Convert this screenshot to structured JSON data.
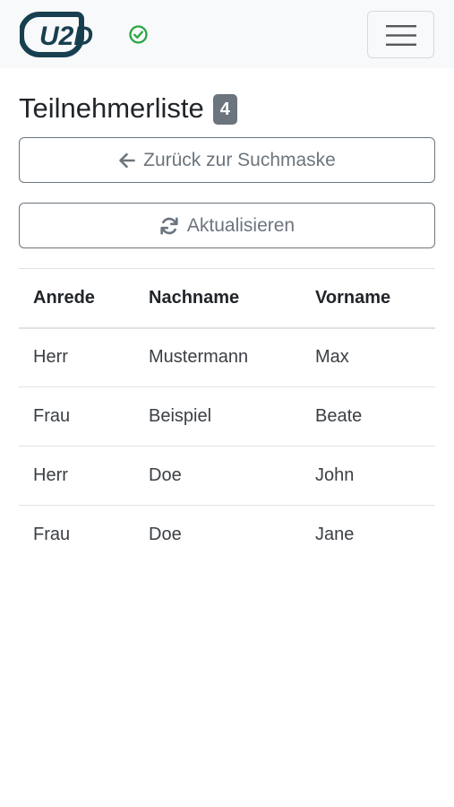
{
  "navbar": {
    "logo_text": "U2D",
    "logo_icon": "u2d-logo",
    "status_icon": "check-circle-icon",
    "status_color": "#28a745",
    "menu_icon": "hamburger-icon"
  },
  "page": {
    "title": "Teilnehmerliste",
    "count_badge": "4",
    "back_button_label": "Zurück zur Suchmaske",
    "back_button_icon": "arrow-left-icon",
    "refresh_button_label": "Aktualisieren",
    "refresh_button_icon": "refresh-icon"
  },
  "table": {
    "headers": [
      "Anrede",
      "Nachname",
      "Vorname"
    ],
    "rows": [
      [
        "Herr",
        "Mustermann",
        "Max"
      ],
      [
        "Frau",
        "Beispiel",
        "Beate"
      ],
      [
        "Herr",
        "Doe",
        "John"
      ],
      [
        "Frau",
        "Doe",
        "Jane"
      ]
    ]
  },
  "colors": {
    "brand": "#173f4f",
    "secondary": "#6c757d",
    "navbar_bg": "#f8f9fa"
  }
}
